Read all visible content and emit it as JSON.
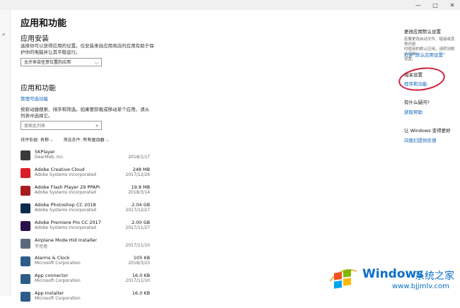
{
  "window": {
    "controls": [
      "—",
      "□",
      "✕"
    ]
  },
  "sidebar": {
    "search_glyph": "⌕"
  },
  "main": {
    "page_title": "应用和功能",
    "install_section": {
      "heading": "应用安装",
      "description_line1": "选择你可以获得应用的位置。仅安装来自应用商店的应用有助于保",
      "description_line2": "护你的电脑并让其平稳运行。",
      "dropdown_value": "允许来自任意位置的应用"
    },
    "apps_section": {
      "heading": "应用和功能",
      "manage_link": "管理可选功能",
      "description_line1": "按驱动器搜索、排序和筛选。如果要卸载或移动某个应用，请从",
      "description_line2": "列表中选择它。",
      "search_placeholder": "搜索此列表",
      "sort_label": "排序依据:",
      "sort_value": "名称",
      "filter_label": "筛选条件:",
      "filter_value": "所有驱动器"
    },
    "apps": [
      {
        "name": "5KPlayer",
        "publisher": "DearMob, Inc.",
        "size": "",
        "date": "2018/1/17",
        "color": "#3a3a3a"
      },
      {
        "name": "Adobe Creative Cloud",
        "publisher": "Adobe Systems Incorporated",
        "size": "248 MB",
        "date": "2017/12/26",
        "color": "#da1f26"
      },
      {
        "name": "Adobe Flash Player 29 PPAPI",
        "publisher": "Adobe Systems Incorporated",
        "size": "19.8 MB",
        "date": "2018/3/14",
        "color": "#a81d1d"
      },
      {
        "name": "Adobe Photoshop CC 2018",
        "publisher": "Adobe Systems Incorporated",
        "size": "2.04 GB",
        "date": "2017/12/27",
        "color": "#0d2b4e"
      },
      {
        "name": "Adobe Premiere Pro CC 2017",
        "publisher": "Adobe Systems Incorporated",
        "size": "2.00 GB",
        "date": "2017/11/27",
        "color": "#2a0f4a"
      },
      {
        "name": "Airplane Mode Hid Installer",
        "publisher": "不可用",
        "size": "",
        "date": "2017/11/10",
        "color": "#5a6a7a"
      },
      {
        "name": "Alarms & Clock",
        "publisher": "Microsoft Corporation",
        "size": "105 KB",
        "date": "2018/3/23",
        "color": "#2d5c8a"
      },
      {
        "name": "App connector",
        "publisher": "Microsoft Corporation",
        "size": "16.0 KB",
        "date": "2017/11/10",
        "color": "#2d5c8a"
      },
      {
        "name": "App Installer",
        "publisher": "Microsoft Corporation",
        "size": "16.0 KB",
        "date": "",
        "color": "#2d5c8a"
      }
    ]
  },
  "right": {
    "default_heading": "更改应用默认设置",
    "default_desc_line1": "若要更改启动文件、链接或其他内容",
    "default_desc_line2": "时使用的默认应用，请转到默认应用",
    "default_desc_line3": "设置。",
    "default_link": "打开\"默认应用设置\"",
    "related_heading": "相关设置",
    "related_link": "程序和功能",
    "question_heading": "有什么疑问?",
    "help_link": "获取帮助",
    "improve_heading": "让 Windows 变得更好",
    "feedback_link": "向我们提供反馈"
  },
  "watermark": {
    "brand": "Windows",
    "cn": "系统之家",
    "url": "www.bjjmlv.com"
  }
}
